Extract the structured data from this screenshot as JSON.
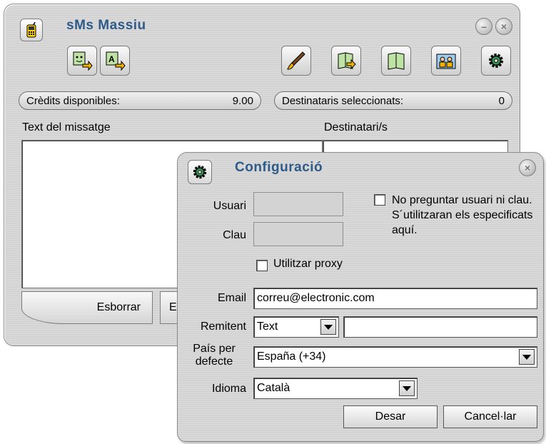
{
  "main": {
    "title": "sMs Massiu",
    "icons": {
      "app": "mobile-phone-icon",
      "tool1": "message-import-icon",
      "tool2": "text-import-icon",
      "tool3": "brush-icon",
      "tool4": "address-book-import-icon",
      "tool5": "address-book-icon",
      "tool6": "contacts-group-icon",
      "tool7": "settings-gear-icon"
    },
    "credits_label": "Crèdits disponibles:",
    "credits_value": "9.00",
    "recipients_label": "Destinataris seleccionats:",
    "recipients_value": "0",
    "message_label": "Text del missatge",
    "recipients_list_label": "Destinatari/s",
    "clear_button": "Esborrar",
    "second_button_partial": "E"
  },
  "dialog": {
    "title": "Configuració",
    "user_label": "Usuari",
    "user_value": "",
    "password_label": "Clau",
    "password_value": "",
    "no_ask_checkbox_label": "No preguntar usuari ni clau. S´utilitzaran els especificats aquí.",
    "no_ask_checked": false,
    "proxy_label": "Utilitzar proxy",
    "proxy_checked": false,
    "email_label": "Email",
    "email_value": "correu@electronic.com",
    "sender_label": "Remitent",
    "sender_type": "Text",
    "sender_value": "",
    "country_label": "País per defecte",
    "country_value": "España (+34)",
    "language_label": "Idioma",
    "language_value": "Català",
    "save_button": "Desar",
    "cancel_button": "Cancel·lar"
  },
  "colors": {
    "title": "#2e5a8a",
    "window_bg": "#d6d6d6"
  }
}
